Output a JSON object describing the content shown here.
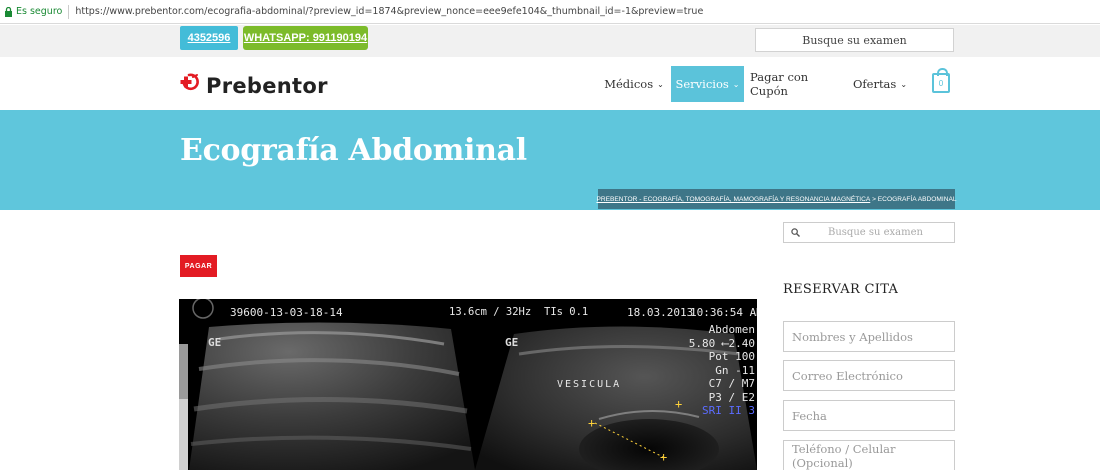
{
  "browser": {
    "secure_label": "Es seguro",
    "url": "https://www.prebentor.com/ecografia-abdominal/?preview_id=1874&preview_nonce=eee9efe104&_thumbnail_id=-1&preview=true"
  },
  "topbar": {
    "phone": "4352596",
    "whatsapp": "WHATSAPP: 991190194",
    "search_placeholder": "Busque su examen"
  },
  "header": {
    "logo_text": "Prebentor",
    "nav": [
      {
        "label": "Médicos"
      },
      {
        "label": "Servicios"
      },
      {
        "label": "Pagar con Cupón"
      },
      {
        "label": "Ofertas"
      }
    ],
    "cart_count": "0"
  },
  "hero": {
    "title": "Ecografía Abdominal",
    "breadcrumb_link": "PREBENTOR - ECOGRAFÍA, TOMOGRAFÍA, MAMOGRAFÍA Y RESONANCIA MAGNÉTICA",
    "breadcrumb_sep": " > ",
    "breadcrumb_current": "ECOGRAFÍA ABDOMINAL"
  },
  "content": {
    "pay_button": "PAGAR"
  },
  "sidebar": {
    "search_placeholder": "Busque su examen",
    "reservar_title": "RESERVAR CITA",
    "fields": [
      "Nombres y Apellidos",
      "Correo Electrónico",
      "Fecha",
      "Teléfono / Celular (Opcional)"
    ]
  },
  "ultrasound": {
    "id": "39600-13-03-18-14",
    "depth": "13.6cm / 32Hz",
    "tis": "TIs  0.1",
    "date": "18.03.2013",
    "time": "10:36:54 AM",
    "params": [
      "Abdomen",
      "5.80 ⟵2.40",
      "Pot 100",
      "Gn -11",
      "C7 / M7",
      "P3 / E2",
      "SRI II 3"
    ],
    "label": "VESICULA",
    "ge_left": "GE",
    "ge_right": "GE"
  },
  "colors": {
    "accent": "#5fc6dc",
    "whatsapp": "#7cbb2a",
    "phone": "#43bcd8",
    "pay": "#e31b23",
    "breadcrumb_bg": "#3e7688"
  }
}
